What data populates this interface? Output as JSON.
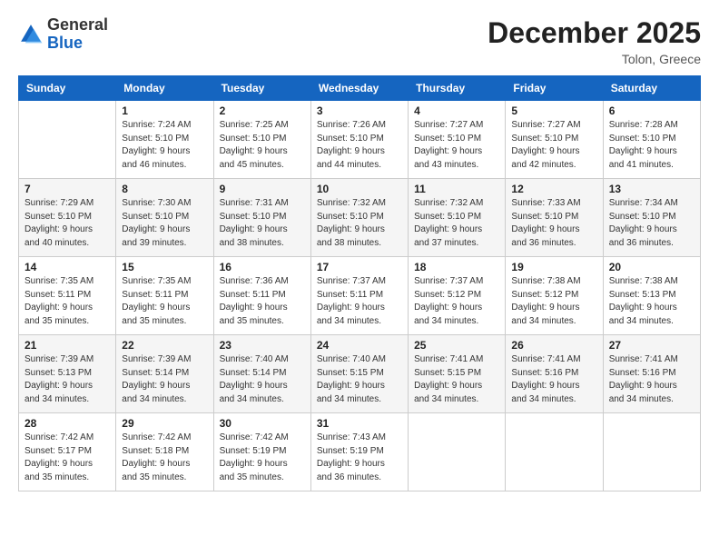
{
  "logo": {
    "general": "General",
    "blue": "Blue"
  },
  "header": {
    "month": "December 2025",
    "location": "Tolon, Greece"
  },
  "weekdays": [
    "Sunday",
    "Monday",
    "Tuesday",
    "Wednesday",
    "Thursday",
    "Friday",
    "Saturday"
  ],
  "weeks": [
    [
      {
        "day": "",
        "sunrise": "",
        "sunset": "",
        "daylight": ""
      },
      {
        "day": "1",
        "sunrise": "Sunrise: 7:24 AM",
        "sunset": "Sunset: 5:10 PM",
        "daylight": "Daylight: 9 hours and 46 minutes."
      },
      {
        "day": "2",
        "sunrise": "Sunrise: 7:25 AM",
        "sunset": "Sunset: 5:10 PM",
        "daylight": "Daylight: 9 hours and 45 minutes."
      },
      {
        "day": "3",
        "sunrise": "Sunrise: 7:26 AM",
        "sunset": "Sunset: 5:10 PM",
        "daylight": "Daylight: 9 hours and 44 minutes."
      },
      {
        "day": "4",
        "sunrise": "Sunrise: 7:27 AM",
        "sunset": "Sunset: 5:10 PM",
        "daylight": "Daylight: 9 hours and 43 minutes."
      },
      {
        "day": "5",
        "sunrise": "Sunrise: 7:27 AM",
        "sunset": "Sunset: 5:10 PM",
        "daylight": "Daylight: 9 hours and 42 minutes."
      },
      {
        "day": "6",
        "sunrise": "Sunrise: 7:28 AM",
        "sunset": "Sunset: 5:10 PM",
        "daylight": "Daylight: 9 hours and 41 minutes."
      }
    ],
    [
      {
        "day": "7",
        "sunrise": "Sunrise: 7:29 AM",
        "sunset": "Sunset: 5:10 PM",
        "daylight": "Daylight: 9 hours and 40 minutes."
      },
      {
        "day": "8",
        "sunrise": "Sunrise: 7:30 AM",
        "sunset": "Sunset: 5:10 PM",
        "daylight": "Daylight: 9 hours and 39 minutes."
      },
      {
        "day": "9",
        "sunrise": "Sunrise: 7:31 AM",
        "sunset": "Sunset: 5:10 PM",
        "daylight": "Daylight: 9 hours and 38 minutes."
      },
      {
        "day": "10",
        "sunrise": "Sunrise: 7:32 AM",
        "sunset": "Sunset: 5:10 PM",
        "daylight": "Daylight: 9 hours and 38 minutes."
      },
      {
        "day": "11",
        "sunrise": "Sunrise: 7:32 AM",
        "sunset": "Sunset: 5:10 PM",
        "daylight": "Daylight: 9 hours and 37 minutes."
      },
      {
        "day": "12",
        "sunrise": "Sunrise: 7:33 AM",
        "sunset": "Sunset: 5:10 PM",
        "daylight": "Daylight: 9 hours and 36 minutes."
      },
      {
        "day": "13",
        "sunrise": "Sunrise: 7:34 AM",
        "sunset": "Sunset: 5:10 PM",
        "daylight": "Daylight: 9 hours and 36 minutes."
      }
    ],
    [
      {
        "day": "14",
        "sunrise": "Sunrise: 7:35 AM",
        "sunset": "Sunset: 5:11 PM",
        "daylight": "Daylight: 9 hours and 35 minutes."
      },
      {
        "day": "15",
        "sunrise": "Sunrise: 7:35 AM",
        "sunset": "Sunset: 5:11 PM",
        "daylight": "Daylight: 9 hours and 35 minutes."
      },
      {
        "day": "16",
        "sunrise": "Sunrise: 7:36 AM",
        "sunset": "Sunset: 5:11 PM",
        "daylight": "Daylight: 9 hours and 35 minutes."
      },
      {
        "day": "17",
        "sunrise": "Sunrise: 7:37 AM",
        "sunset": "Sunset: 5:11 PM",
        "daylight": "Daylight: 9 hours and 34 minutes."
      },
      {
        "day": "18",
        "sunrise": "Sunrise: 7:37 AM",
        "sunset": "Sunset: 5:12 PM",
        "daylight": "Daylight: 9 hours and 34 minutes."
      },
      {
        "day": "19",
        "sunrise": "Sunrise: 7:38 AM",
        "sunset": "Sunset: 5:12 PM",
        "daylight": "Daylight: 9 hours and 34 minutes."
      },
      {
        "day": "20",
        "sunrise": "Sunrise: 7:38 AM",
        "sunset": "Sunset: 5:13 PM",
        "daylight": "Daylight: 9 hours and 34 minutes."
      }
    ],
    [
      {
        "day": "21",
        "sunrise": "Sunrise: 7:39 AM",
        "sunset": "Sunset: 5:13 PM",
        "daylight": "Daylight: 9 hours and 34 minutes."
      },
      {
        "day": "22",
        "sunrise": "Sunrise: 7:39 AM",
        "sunset": "Sunset: 5:14 PM",
        "daylight": "Daylight: 9 hours and 34 minutes."
      },
      {
        "day": "23",
        "sunrise": "Sunrise: 7:40 AM",
        "sunset": "Sunset: 5:14 PM",
        "daylight": "Daylight: 9 hours and 34 minutes."
      },
      {
        "day": "24",
        "sunrise": "Sunrise: 7:40 AM",
        "sunset": "Sunset: 5:15 PM",
        "daylight": "Daylight: 9 hours and 34 minutes."
      },
      {
        "day": "25",
        "sunrise": "Sunrise: 7:41 AM",
        "sunset": "Sunset: 5:15 PM",
        "daylight": "Daylight: 9 hours and 34 minutes."
      },
      {
        "day": "26",
        "sunrise": "Sunrise: 7:41 AM",
        "sunset": "Sunset: 5:16 PM",
        "daylight": "Daylight: 9 hours and 34 minutes."
      },
      {
        "day": "27",
        "sunrise": "Sunrise: 7:41 AM",
        "sunset": "Sunset: 5:16 PM",
        "daylight": "Daylight: 9 hours and 34 minutes."
      }
    ],
    [
      {
        "day": "28",
        "sunrise": "Sunrise: 7:42 AM",
        "sunset": "Sunset: 5:17 PM",
        "daylight": "Daylight: 9 hours and 35 minutes."
      },
      {
        "day": "29",
        "sunrise": "Sunrise: 7:42 AM",
        "sunset": "Sunset: 5:18 PM",
        "daylight": "Daylight: 9 hours and 35 minutes."
      },
      {
        "day": "30",
        "sunrise": "Sunrise: 7:42 AM",
        "sunset": "Sunset: 5:19 PM",
        "daylight": "Daylight: 9 hours and 35 minutes."
      },
      {
        "day": "31",
        "sunrise": "Sunrise: 7:43 AM",
        "sunset": "Sunset: 5:19 PM",
        "daylight": "Daylight: 9 hours and 36 minutes."
      },
      {
        "day": "",
        "sunrise": "",
        "sunset": "",
        "daylight": ""
      },
      {
        "day": "",
        "sunrise": "",
        "sunset": "",
        "daylight": ""
      },
      {
        "day": "",
        "sunrise": "",
        "sunset": "",
        "daylight": ""
      }
    ]
  ]
}
